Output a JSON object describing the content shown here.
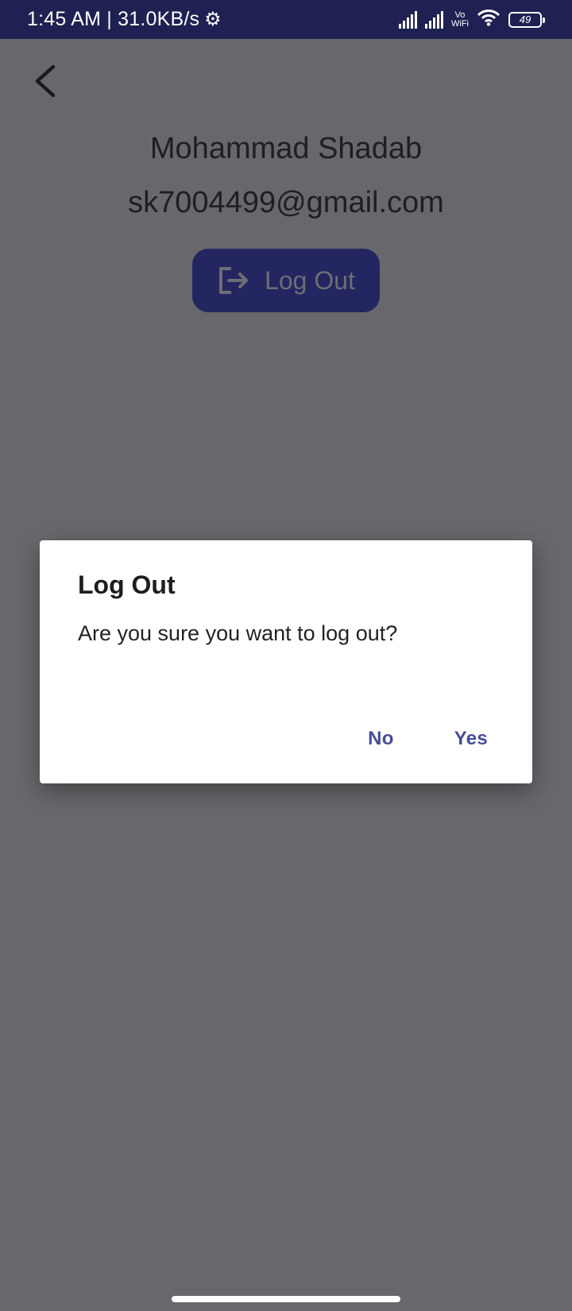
{
  "status_bar": {
    "time_speed": "1:45 AM | 31.0KB/s",
    "settings_icon": "gear-icon",
    "network_label_top": "Vo",
    "network_label_bottom": "WiFi",
    "battery_level": "49"
  },
  "toolbar": {
    "back_icon": "chevron-left-icon"
  },
  "profile": {
    "name": "Mohammad Shadab",
    "email": "sk7004499@gmail.com",
    "logout_label": "Log Out",
    "logout_icon": "logout-icon"
  },
  "dialog": {
    "title": "Log Out",
    "message": "Are you sure you want to log out?",
    "no_label": "No",
    "yes_label": "Yes"
  },
  "colors": {
    "status_bar_bg": "#1f2152",
    "scrim_bg": "#68676b",
    "logout_button_bg": "#232660",
    "dialog_action_text": "#474c99"
  }
}
